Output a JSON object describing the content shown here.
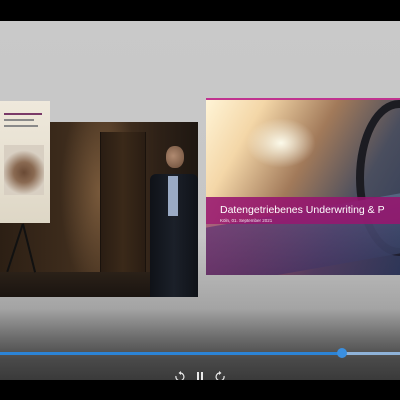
{
  "slide": {
    "title": "Datengetriebenes Underwriting & P",
    "subtitle": "Köln, 01. September 2021"
  },
  "player": {
    "progress": 0.855,
    "controls": {
      "rewind_icon": "rewind-10-icon",
      "pause_icon": "pause-icon",
      "forward_icon": "forward-10-icon"
    }
  },
  "colors": {
    "accent": "#c0338f",
    "progress": "#2c84d6"
  }
}
